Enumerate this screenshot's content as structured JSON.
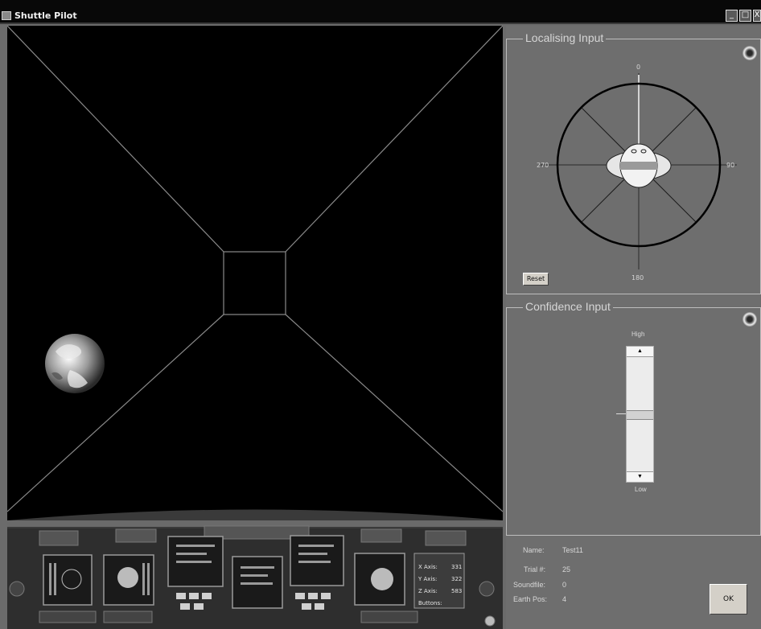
{
  "window": {
    "title": "Shuttle Pilot",
    "minimize": "_",
    "maximize": "□",
    "close": "X"
  },
  "localising": {
    "title": "Localising Input",
    "angles": {
      "top": "0",
      "right": "90",
      "bottom": "180",
      "left": "270"
    },
    "reset_label": "Reset"
  },
  "confidence": {
    "title": "Confidence Input",
    "high_label": "High",
    "low_label": "Low",
    "level": 0.5
  },
  "dashboard": {
    "x_axis_label": "X Axis:",
    "x_axis_value": "331",
    "y_axis_label": "Y Axis:",
    "y_axis_value": "322",
    "z_axis_label": "Z Axis:",
    "z_axis_value": "583",
    "buttons_label": "Buttons:"
  },
  "info": {
    "name_label": "Name:",
    "name_value": "Test11",
    "trial_label": "Trial #:",
    "trial_value": "25",
    "soundfile_label": "Soundfile:",
    "soundfile_value": "0",
    "earth_label": "Earth Pos:",
    "earth_value": "4"
  },
  "ok_label": "OK",
  "colors": {
    "panel": "#6e6e6e",
    "viewport": "#000000",
    "grid_lines": "#8a8a8a"
  }
}
